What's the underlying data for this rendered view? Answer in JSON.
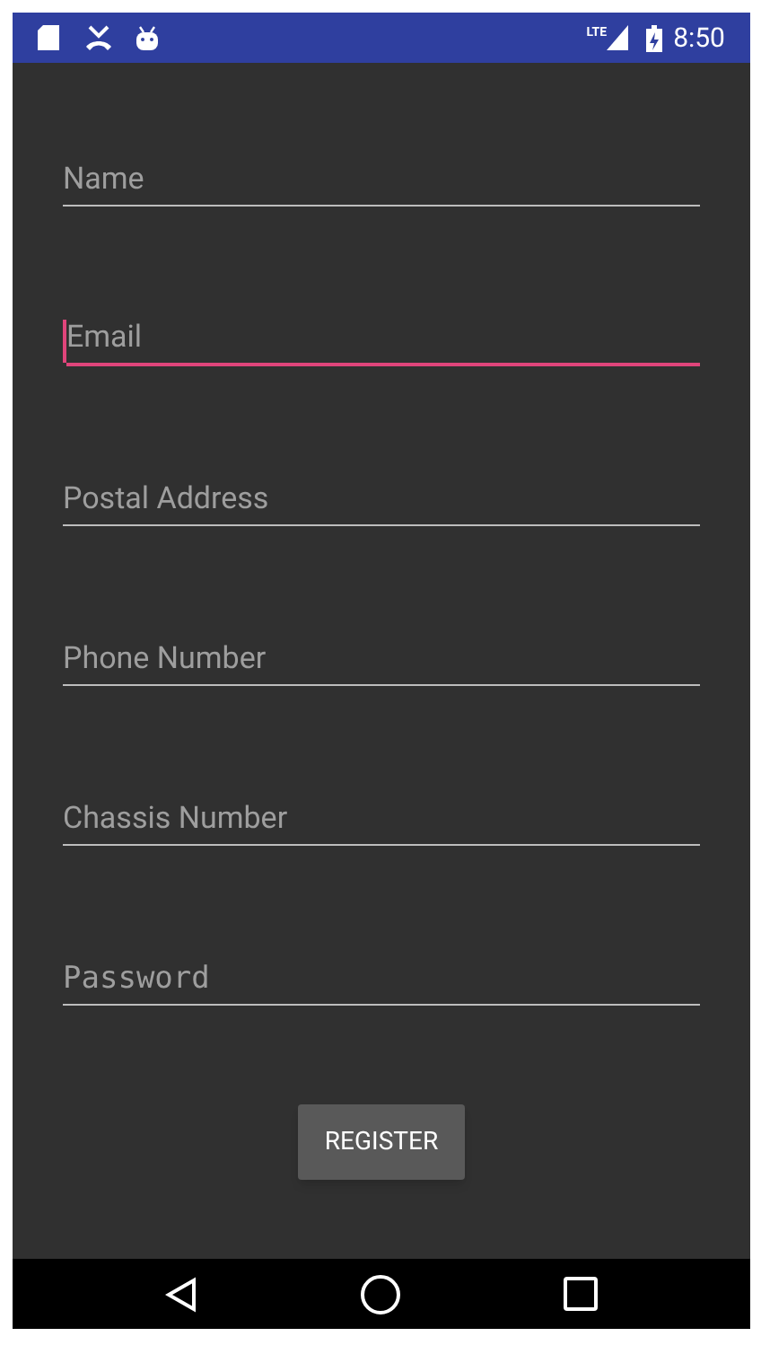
{
  "status_bar": {
    "time": "8:50",
    "network": "LTE"
  },
  "fields": [
    {
      "placeholder": "Name",
      "kind": "text",
      "focused": false
    },
    {
      "placeholder": "Email",
      "kind": "text",
      "focused": true
    },
    {
      "placeholder": "Postal Address",
      "kind": "text",
      "focused": false
    },
    {
      "placeholder": "Phone Number",
      "kind": "text",
      "focused": false
    },
    {
      "placeholder": "Chassis Number",
      "kind": "text",
      "focused": false
    },
    {
      "placeholder": "Password",
      "kind": "password",
      "focused": false
    }
  ],
  "register_button": "REGISTER"
}
